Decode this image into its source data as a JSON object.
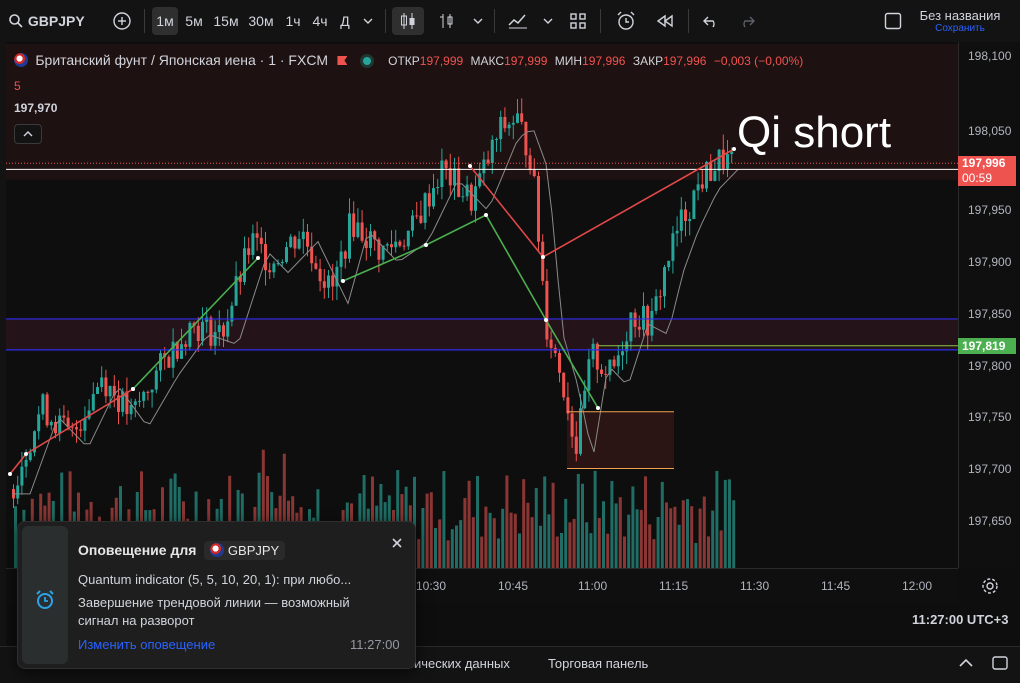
{
  "toolbar": {
    "symbol": "GBPJPY",
    "intervals": [
      "1м",
      "5м",
      "15м",
      "30м",
      "1ч",
      "4ч",
      "Д"
    ],
    "selected_interval": "1м",
    "layout_name": "Без названия",
    "layout_save": "Сохранить"
  },
  "legend": {
    "title": "Британский фунт / Японская иена · 1 · FXCM",
    "sub_value": "5",
    "indicator_value": "197,970",
    "open_label": "ОТКР",
    "open_value": "197,999",
    "high_label": "МАКС",
    "high_value": "197,999",
    "low_label": "МИН",
    "low_value": "197,996",
    "close_label": "ЗАКР",
    "close_value": "197,996",
    "change": "−0,003 (−0,00%)"
  },
  "annotation_text": "Qi short",
  "price_axis": {
    "labels": [
      "198,100",
      "198,050",
      "198,000",
      "197,950",
      "197,900",
      "197,850",
      "197,800",
      "197,750",
      "197,700",
      "197,650"
    ],
    "current_price": "197,996",
    "countdown": "00:59",
    "level_price": "197,819"
  },
  "time_axis": {
    "labels": [
      "10:30",
      "10:45",
      "11:00",
      "11:15",
      "11:30",
      "11:45",
      "12:00"
    ],
    "clock": "11:27:00 UTC+3"
  },
  "bottom_tabs": [
    "ических данных",
    "Торговая панель"
  ],
  "alert": {
    "title": "Оповещение для",
    "symbol": "GBPJPY",
    "line1": "Quantum indicator (5, 5, 10, 20, 1): при любо...",
    "line2": "Завершение трендовой линии — возможный сигнал на разворот",
    "edit_link": "Изменить оповещение",
    "time": "11:27:00"
  },
  "colors": {
    "up": "#26a69a",
    "down": "#ef5350",
    "blue_level": "#2d2df2",
    "green_level": "#8bc34a",
    "orange_zone": "#f0a050",
    "background": "#0e0e0e",
    "link": "#2962ff"
  }
}
